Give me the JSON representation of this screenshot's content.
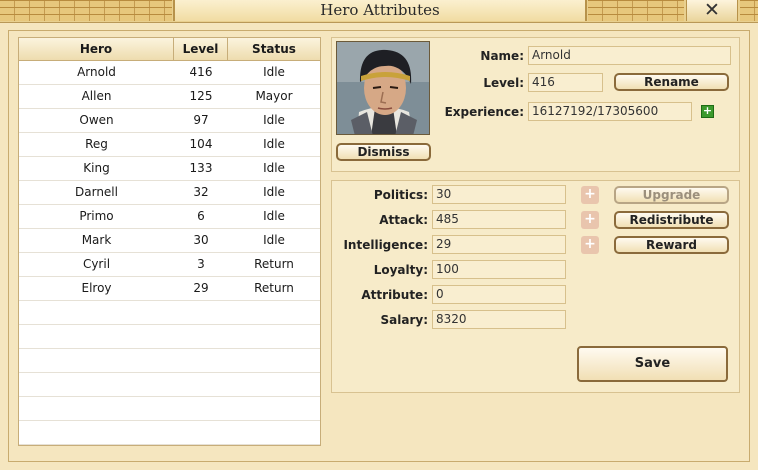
{
  "window": {
    "title": "Hero Attributes",
    "close_label": "✕"
  },
  "table": {
    "headers": [
      "Hero",
      "Level",
      "Status"
    ],
    "rows": [
      [
        "Arnold",
        "416",
        "Idle"
      ],
      [
        "Allen",
        "125",
        "Mayor"
      ],
      [
        "Owen",
        "97",
        "Idle"
      ],
      [
        "Reg",
        "104",
        "Idle"
      ],
      [
        "King",
        "133",
        "Idle"
      ],
      [
        "Darnell",
        "32",
        "Idle"
      ],
      [
        "Primo",
        "6",
        "Idle"
      ],
      [
        "Mark",
        "30",
        "Idle"
      ],
      [
        "Cyril",
        "3",
        "Return"
      ],
      [
        "Elroy",
        "29",
        "Return"
      ],
      [
        "",
        "",
        ""
      ],
      [
        "",
        "",
        ""
      ],
      [
        "",
        "",
        ""
      ],
      [
        "",
        "",
        ""
      ],
      [
        "",
        "",
        ""
      ],
      [
        "",
        "",
        ""
      ]
    ]
  },
  "hero": {
    "name_label": "Name:",
    "name": "Arnold",
    "level_label": "Level:",
    "level": "416",
    "exp_label": "Experience:",
    "experience": "16127192/17305600",
    "rename_label": "Rename",
    "dismiss_label": "Dismiss"
  },
  "attributes": {
    "politics_label": "Politics:",
    "politics": "30",
    "attack_label": "Attack:",
    "attack": "485",
    "intelligence_label": "Intelligence:",
    "intelligence": "29",
    "loyalty_label": "Loyalty:",
    "loyalty": "100",
    "attribute_label": "Attribute:",
    "attribute": "0",
    "salary_label": "Salary:",
    "salary": "8320",
    "plus_label": "+",
    "upgrade_label": "Upgrade",
    "redistribute_label": "Redistribute",
    "reward_label": "Reward",
    "save_label": "Save"
  },
  "colors": {
    "background": "#f5e6bf",
    "panel": "#f7ebc9",
    "button_border": "#8a6a3b",
    "plus_disabled": "#e9c5ad",
    "plus_green": "#3c9a2d"
  }
}
